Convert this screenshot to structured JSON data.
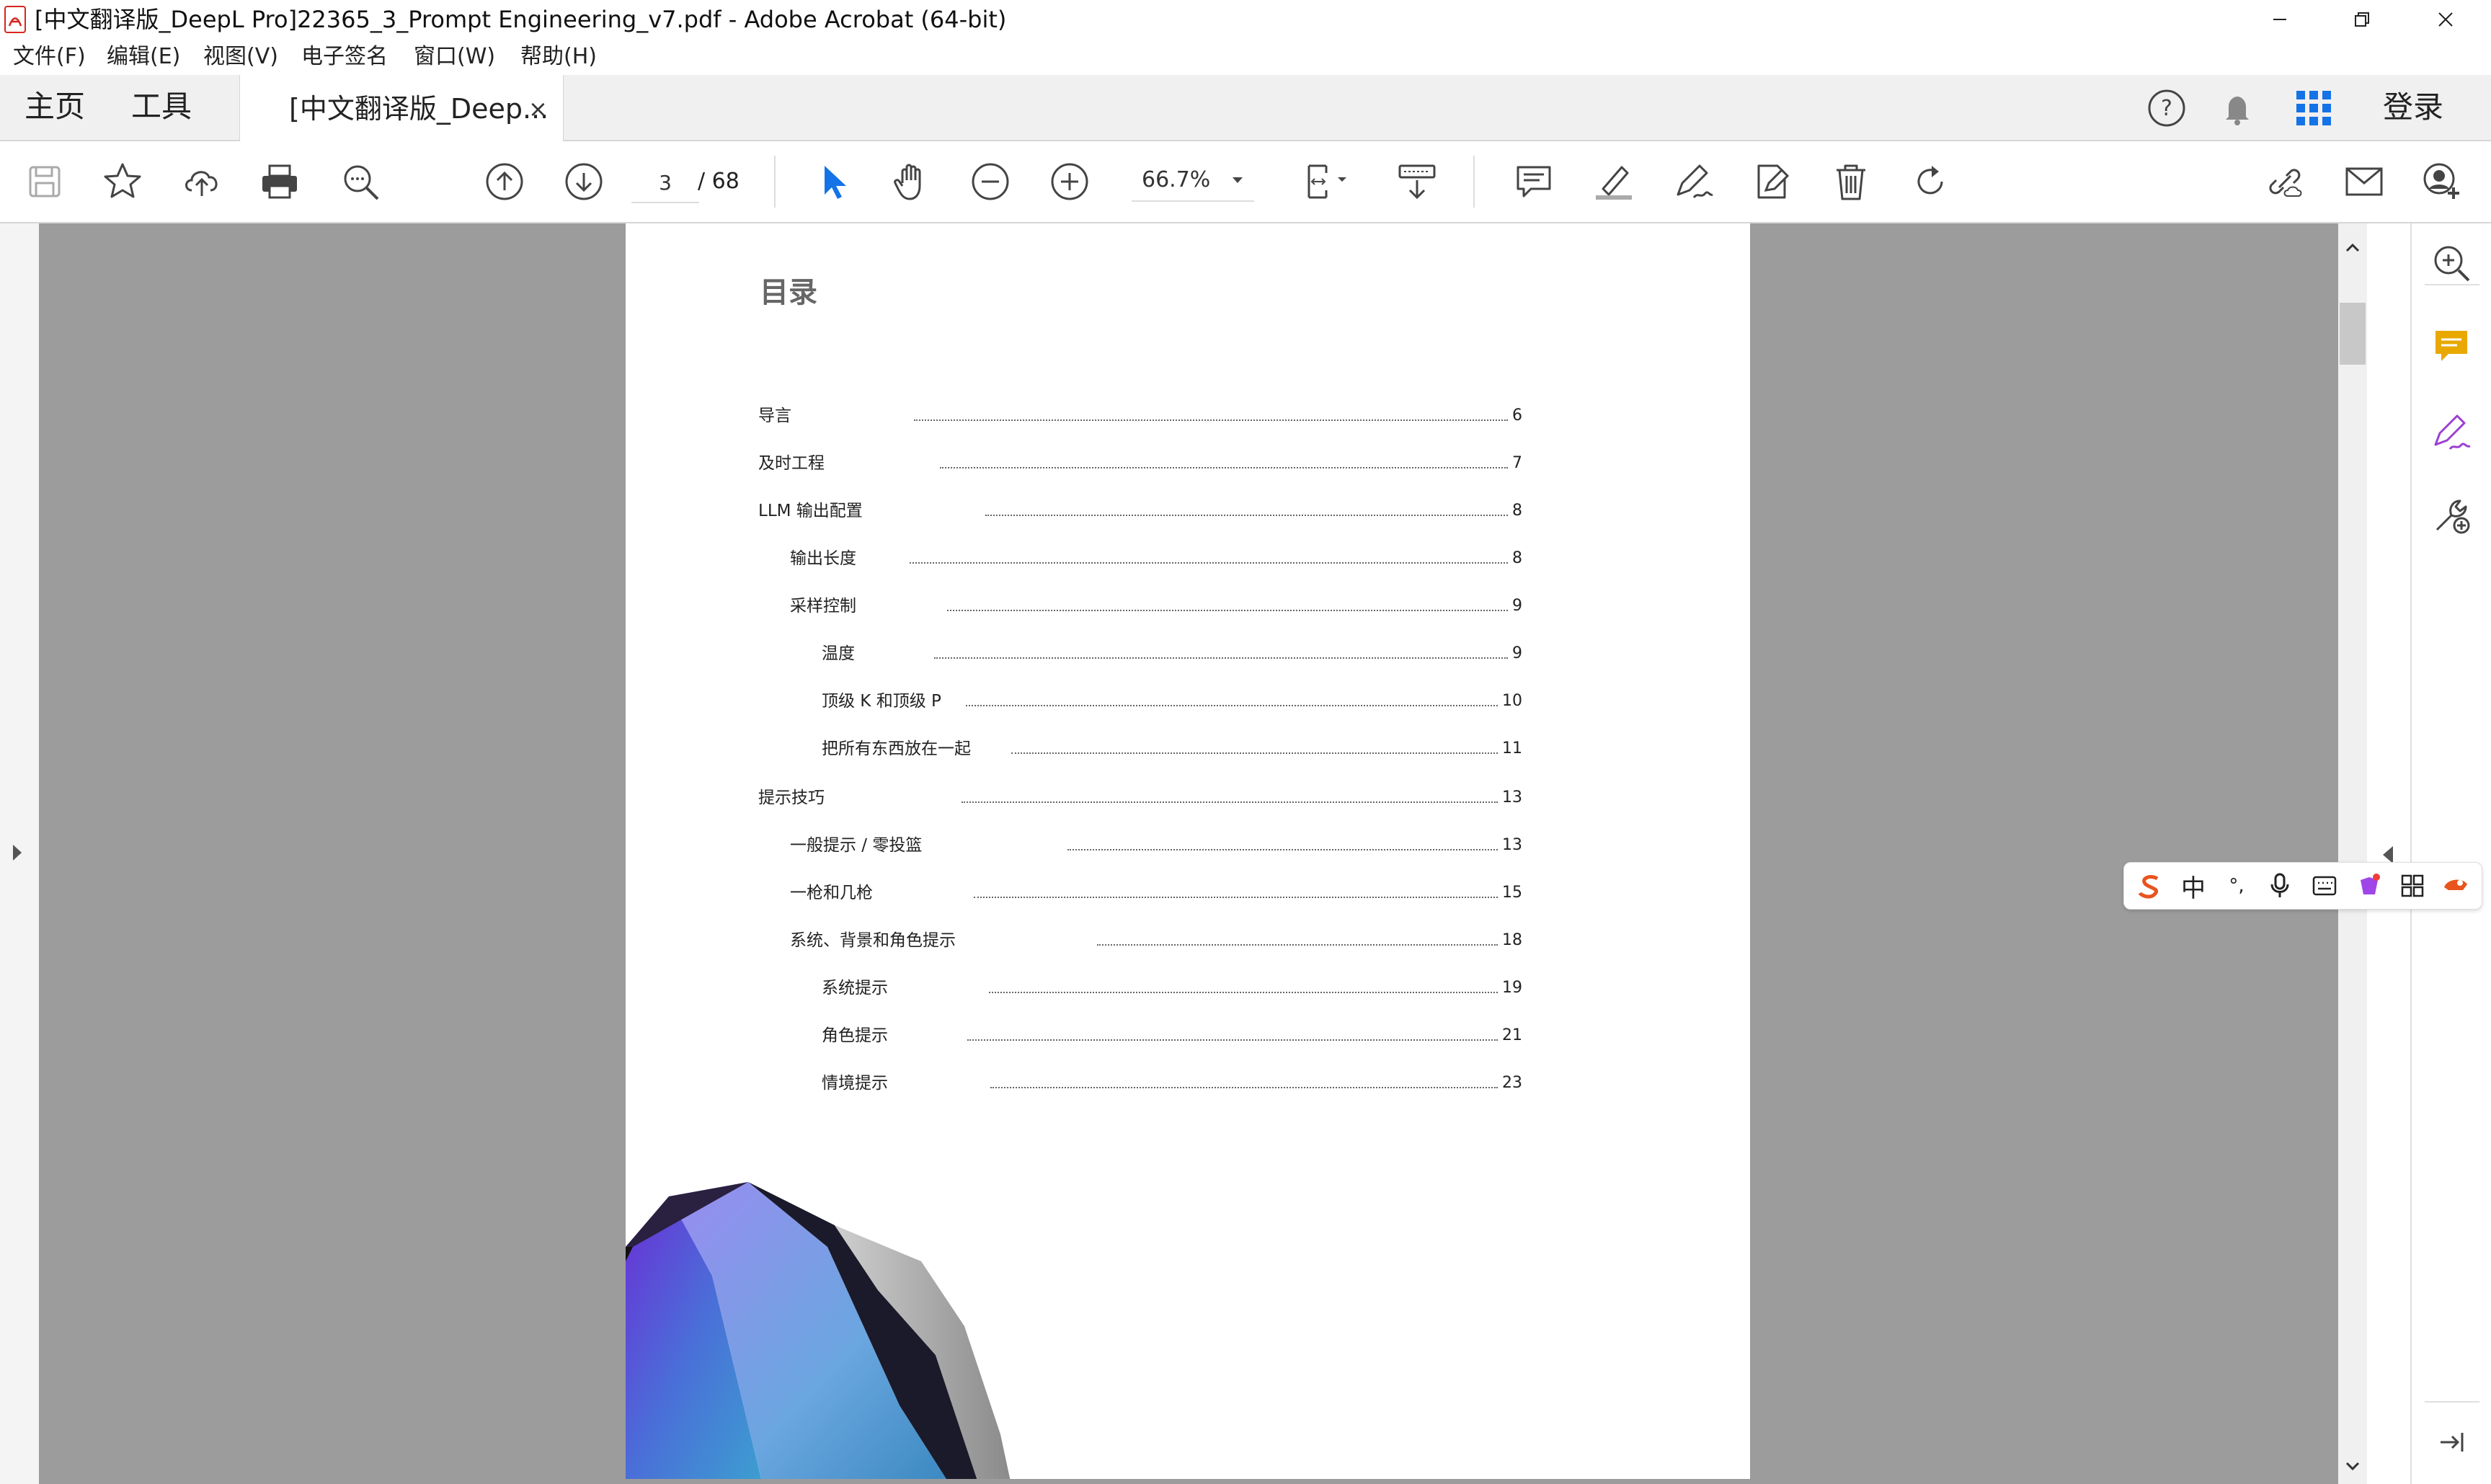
{
  "window": {
    "title": "[中文翻译版_DeepL Pro]22365_3_Prompt Engineering_v7.pdf - Adobe Acrobat (64-bit)"
  },
  "menu": [
    "文件(F)",
    "编辑(E)",
    "视图(V)",
    "电子签名",
    "窗口(W)",
    "帮助(H)"
  ],
  "tabs": {
    "home": "主页",
    "tools": "工具",
    "document": "[中文翻译版_Deep...",
    "close": "×",
    "login": "登录"
  },
  "toolbar": {
    "current_page": "3",
    "total_pages": "/ 68",
    "zoom": "66.7%"
  },
  "toc": {
    "title": "目录",
    "entries": [
      {
        "label": "导言",
        "page": "6"
      },
      {
        "label": "及时工程",
        "page": "7"
      },
      {
        "label": "LLM 输出配置",
        "page": "8"
      },
      {
        "label": "输出长度",
        "page": "8"
      },
      {
        "label": "采样控制",
        "page": "9"
      },
      {
        "label": "温度",
        "page": "9"
      },
      {
        "label": "顶级 K 和顶级 P",
        "page": "10"
      },
      {
        "label": "把所有东西放在一起",
        "page": "11"
      },
      {
        "label": "提示技巧",
        "page": "13"
      },
      {
        "label": "一般提示 / 零投篮",
        "page": "13"
      },
      {
        "label": "一枪和几枪",
        "page": "15"
      },
      {
        "label": "系统、背景和角色提示",
        "page": "18"
      },
      {
        "label": "系统提示",
        "page": "19"
      },
      {
        "label": "角色提示",
        "page": "21"
      },
      {
        "label": "情境提示",
        "page": "23"
      }
    ]
  },
  "ime": {
    "mode": "中",
    "punct": "°,"
  },
  "colors": {
    "viewer_bg": "#9c9c9c",
    "accent_blue": "#1473e6",
    "comment_yellow": "#e8a800",
    "sign_purple": "#9b3fd1"
  }
}
